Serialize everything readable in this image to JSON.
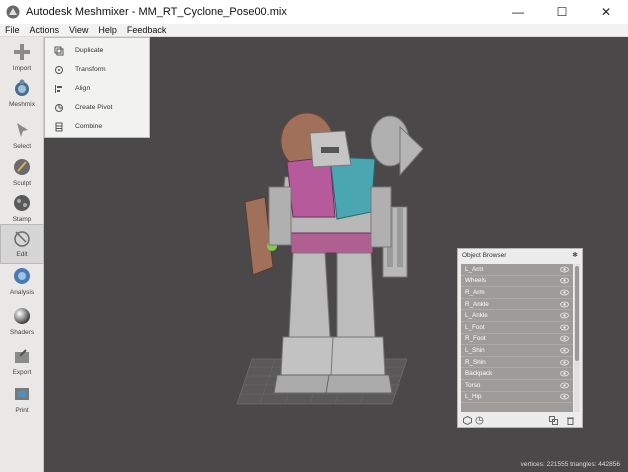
{
  "window": {
    "title": "Autodesk Meshmixer - MM_RT_Cyclone_Pose00.mix",
    "icon": "meshmixer-logo-icon",
    "controls": {
      "minimize": "—",
      "maximize": "☐",
      "close": "✕"
    }
  },
  "menubar": [
    "File",
    "Actions",
    "View",
    "Help",
    "Feedback"
  ],
  "toolbar": [
    {
      "label": "Import",
      "icon": "import-icon"
    },
    {
      "label": "Meshmix",
      "icon": "meshmix-icon"
    },
    {
      "label": "Select",
      "icon": "select-icon"
    },
    {
      "label": "Sculpt",
      "icon": "sculpt-icon"
    },
    {
      "label": "Stamp",
      "icon": "stamp-icon"
    },
    {
      "label": "Edit",
      "icon": "edit-icon"
    },
    {
      "label": "Analysis",
      "icon": "analysis-icon"
    },
    {
      "label": "Shaders",
      "icon": "shaders-icon"
    },
    {
      "label": "Export",
      "icon": "export-icon"
    },
    {
      "label": "Print",
      "icon": "print-icon"
    }
  ],
  "edit_menu": [
    {
      "label": "Duplicate",
      "icon": "duplicate-icon"
    },
    {
      "label": "Transform",
      "icon": "transform-icon"
    },
    {
      "label": "Align",
      "icon": "align-icon"
    },
    {
      "label": "Create Pivot",
      "icon": "pivot-icon"
    },
    {
      "label": "Combine",
      "icon": "combine-icon"
    }
  ],
  "object_browser": {
    "title": "Object Browser",
    "objects": [
      "L_Arm",
      "Wheels",
      "R_Arm",
      "R_Ankle",
      "L_Ankle",
      "L_Foot",
      "R_Foot",
      "L_Shin",
      "R_Shin",
      "Backpack",
      "Torso",
      "L_Hip"
    ]
  },
  "status": "vertices: 221555 triangles: 442856",
  "colors": {
    "viewport_bg": "#4a4848",
    "mesh_gray": "#b8b8b8",
    "mesh_magenta": "#b65a9c",
    "mesh_teal": "#4aa6b0",
    "mesh_brown": "#a0705a",
    "mesh_green": "#7ecb4a"
  }
}
